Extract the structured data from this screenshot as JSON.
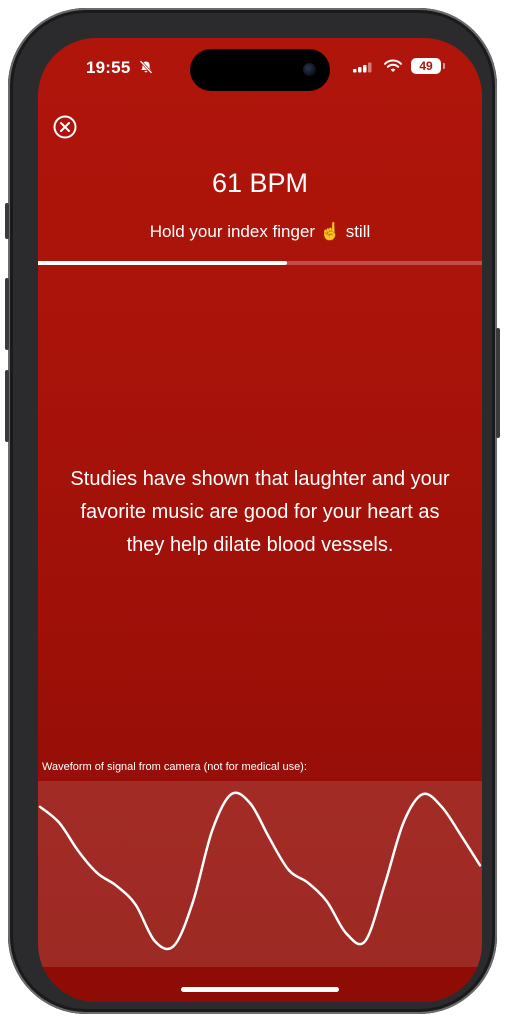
{
  "status_bar": {
    "time": "19:55",
    "silent_icon": "bell-slash-icon",
    "signal_icon": "cellular-signal-icon",
    "wifi_icon": "wifi-icon",
    "battery_level": "49"
  },
  "header": {
    "close_icon": "close-circle-icon",
    "bpm_text": "61 BPM",
    "instruction_text": "Hold your index finger ☝️ still"
  },
  "measurement_progress": 0.56,
  "fact_text": "Studies have shown that laughter and your favorite music are good for your heart as they help dilate blood vessels.",
  "waveform": {
    "label": "Waveform of signal from camera (not for medical use):",
    "samples": [
      0.9,
      0.8,
      0.62,
      0.48,
      0.4,
      0.28,
      0.05,
      0.02,
      0.3,
      0.75,
      0.98,
      0.92,
      0.7,
      0.5,
      0.42,
      0.3,
      0.1,
      0.05,
      0.4,
      0.8,
      0.98,
      0.9,
      0.72,
      0.53
    ]
  },
  "colors": {
    "background": "#a8130a",
    "accent": "#ffffff"
  }
}
